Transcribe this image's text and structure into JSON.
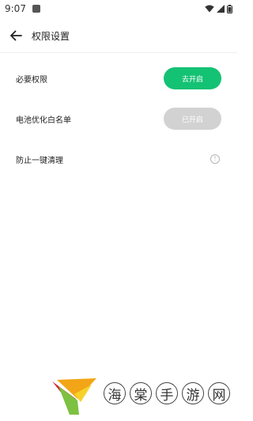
{
  "status_bar": {
    "time": "9:07"
  },
  "header": {
    "title": "权限设置"
  },
  "rows": [
    {
      "label": "必要权限",
      "button_label": "去开启",
      "button_state": "enabled",
      "button_color": "#14c274"
    },
    {
      "label": "电池优化白名单",
      "button_label": "已开启",
      "button_state": "disabled",
      "button_color": "#d2d2d2"
    },
    {
      "label": "防止一键清理",
      "icon": "info-icon"
    }
  ],
  "watermark": {
    "chars": [
      "海",
      "棠",
      "手",
      "游",
      "网"
    ]
  }
}
